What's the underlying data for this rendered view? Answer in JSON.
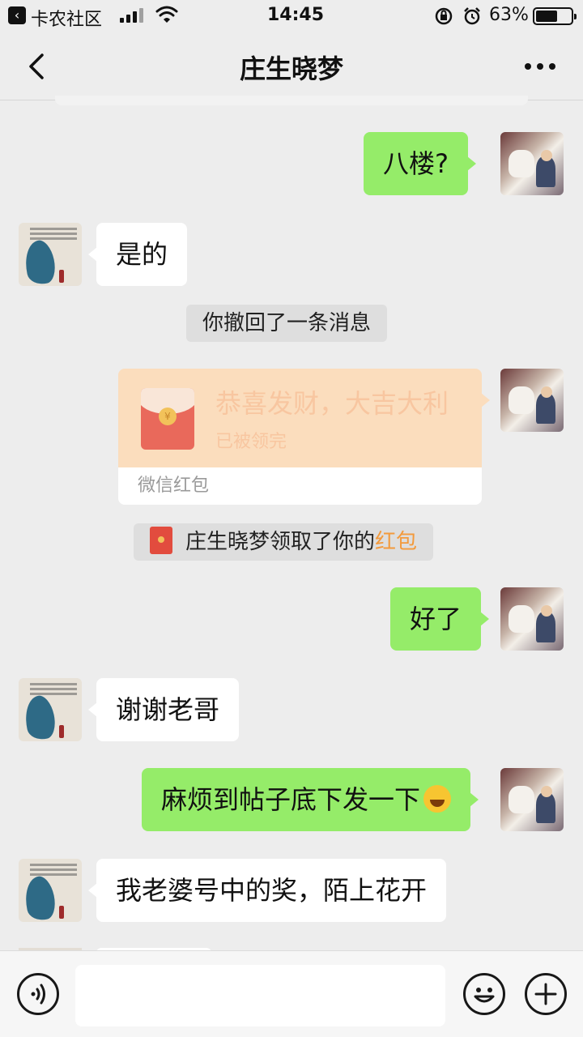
{
  "status_bar": {
    "back_app": "卡农社区",
    "time": "14:45",
    "battery_percent": "63%",
    "battery_level": 0.63,
    "icons": [
      "back-arrow-icon",
      "signal-icon",
      "wifi-icon",
      "rotation-lock-icon",
      "alarm-icon",
      "battery-icon"
    ]
  },
  "nav": {
    "title": "庄生晓梦",
    "icons": [
      "back-chevron-icon",
      "more-dots-icon"
    ]
  },
  "messages": [
    {
      "from": "me",
      "text": "八楼?"
    },
    {
      "from": "other",
      "text": "是的"
    },
    {
      "type": "system",
      "text": "你撤回了一条消息"
    },
    {
      "from": "me",
      "type": "red_packet",
      "title": "恭喜发财，大吉大利",
      "status": "已被领完",
      "footer": "微信红包"
    },
    {
      "type": "system_redpacket",
      "text": "庄生晓梦领取了你的",
      "link": "红包"
    },
    {
      "from": "me",
      "text": "好了"
    },
    {
      "from": "other",
      "text": "谢谢老哥"
    },
    {
      "from": "me",
      "text": "麻烦到帖子底下发一下",
      "emoji": "laughing-crying-emoji"
    },
    {
      "from": "other",
      "text": "我老婆号中的奖，陌上花开"
    }
  ],
  "input_bar": {
    "placeholder": "",
    "icons": [
      "voice-icon",
      "emoji-icon",
      "plus-icon"
    ]
  },
  "colors": {
    "background": "#ededed",
    "bubble_me": "#95ec69",
    "bubble_other": "#ffffff",
    "red_packet": "#fbddbd",
    "accent": "#f39a3c"
  }
}
